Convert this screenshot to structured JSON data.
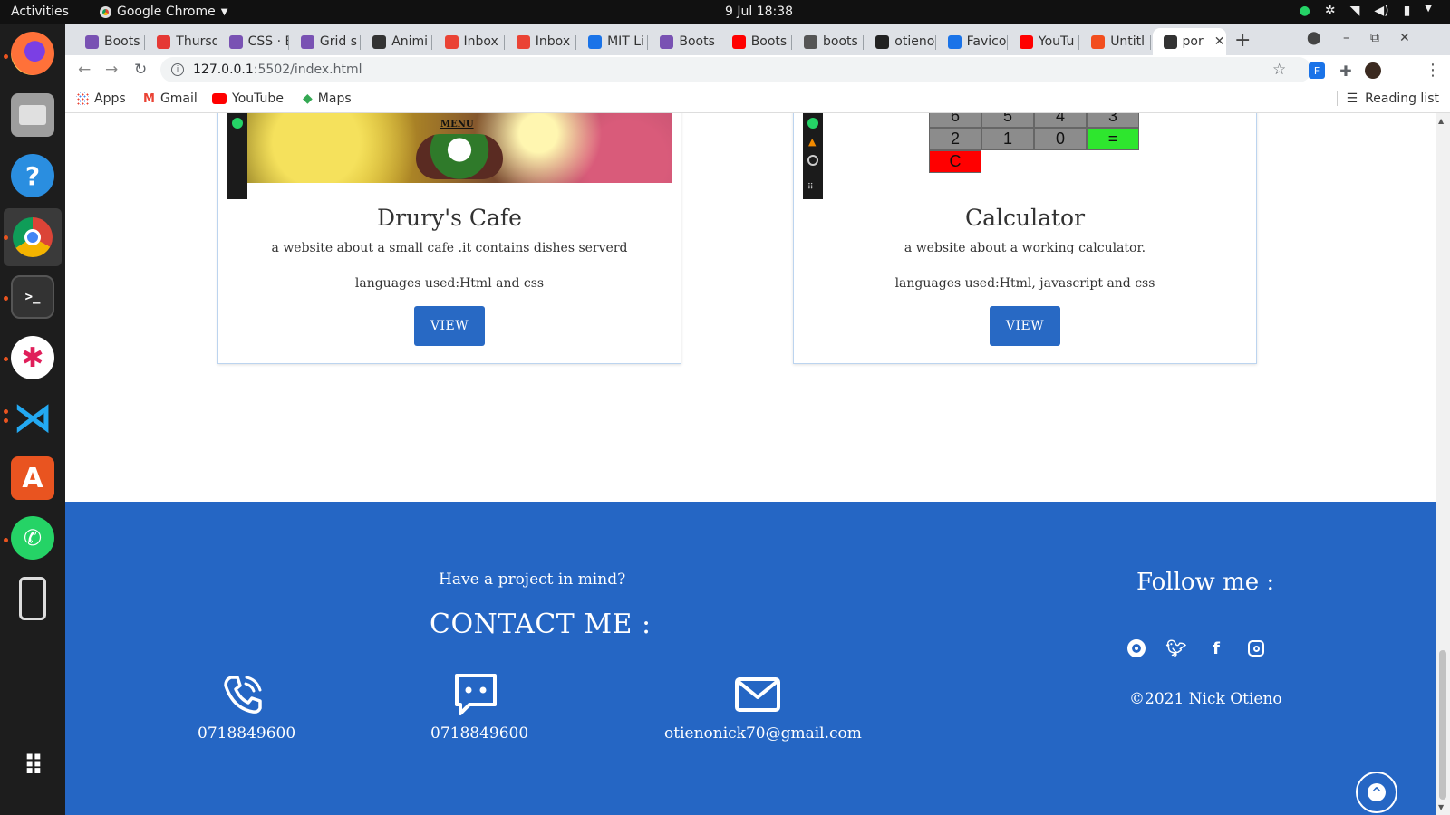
{
  "system": {
    "activities": "Activities",
    "app_name": "Google Chrome",
    "clock": "9 Jul  18:38"
  },
  "tabs": [
    {
      "label": "Boots",
      "icon": "bootstrap-icon",
      "color": "#7952b3"
    },
    {
      "label": "Thursd",
      "icon": "circle-icon",
      "color": "#e53935"
    },
    {
      "label": "CSS · E",
      "icon": "bootstrap-icon",
      "color": "#7952b3"
    },
    {
      "label": "Grid s",
      "icon": "bootstrap-icon",
      "color": "#7952b3"
    },
    {
      "label": "Animi",
      "icon": "a-icon",
      "color": "#333333"
    },
    {
      "label": "Inbox",
      "icon": "gmail-icon",
      "color": "#ea4335"
    },
    {
      "label": "Inbox",
      "icon": "gmail-icon",
      "color": "#ea4335"
    },
    {
      "label": "MIT Li",
      "icon": "code-icon",
      "color": "#1a73e8"
    },
    {
      "label": "Boots",
      "icon": "bootstrap-icon",
      "color": "#7952b3"
    },
    {
      "label": "Boots",
      "icon": "youtube-icon",
      "color": "#ff0000"
    },
    {
      "label": "boots",
      "icon": "globe-icon",
      "color": "#555555"
    },
    {
      "label": "otieno",
      "icon": "github-icon",
      "color": "#222222"
    },
    {
      "label": "Favico",
      "icon": "f-icon",
      "color": "#1a73e8"
    },
    {
      "label": "YouTu",
      "icon": "youtube-icon",
      "color": "#ff0000"
    },
    {
      "label": "Untitl",
      "icon": "figma-icon",
      "color": "#f24e1e"
    },
    {
      "label": "por",
      "icon": "portfolio-icon",
      "color": "#333333"
    }
  ],
  "toolbar": {
    "url_host": "127.0.0.1",
    "url_rest": ":5502/index.html"
  },
  "bookmarks": {
    "apps": "Apps",
    "gmail": "Gmail",
    "youtube": "YouTube",
    "maps": "Maps",
    "reading_list": "Reading list"
  },
  "projects": [
    {
      "title": "Drury's Cafe",
      "description": "a website about a small cafe .it contains dishes serverd",
      "languages": "languages used:Html and css",
      "button": "VIEW",
      "thumb_text": "MENU"
    },
    {
      "title": "Calculator",
      "description": "a website about a working calculator.",
      "languages": "languages used:Html, javascript and css",
      "button": "VIEW",
      "calc_keys": [
        "6",
        "5",
        "4",
        "3",
        "2",
        "1",
        "0",
        "=",
        "C"
      ]
    }
  ],
  "footer": {
    "question": "Have a project in mind?",
    "contact_heading": "CONTACT ME :",
    "phone": "0718849600",
    "message": "0718849600",
    "email": "otienonick70@gmail.com",
    "follow_heading": "Follow me :",
    "copyright": "©2021 Nick Otieno",
    "background": "#2566c4"
  }
}
